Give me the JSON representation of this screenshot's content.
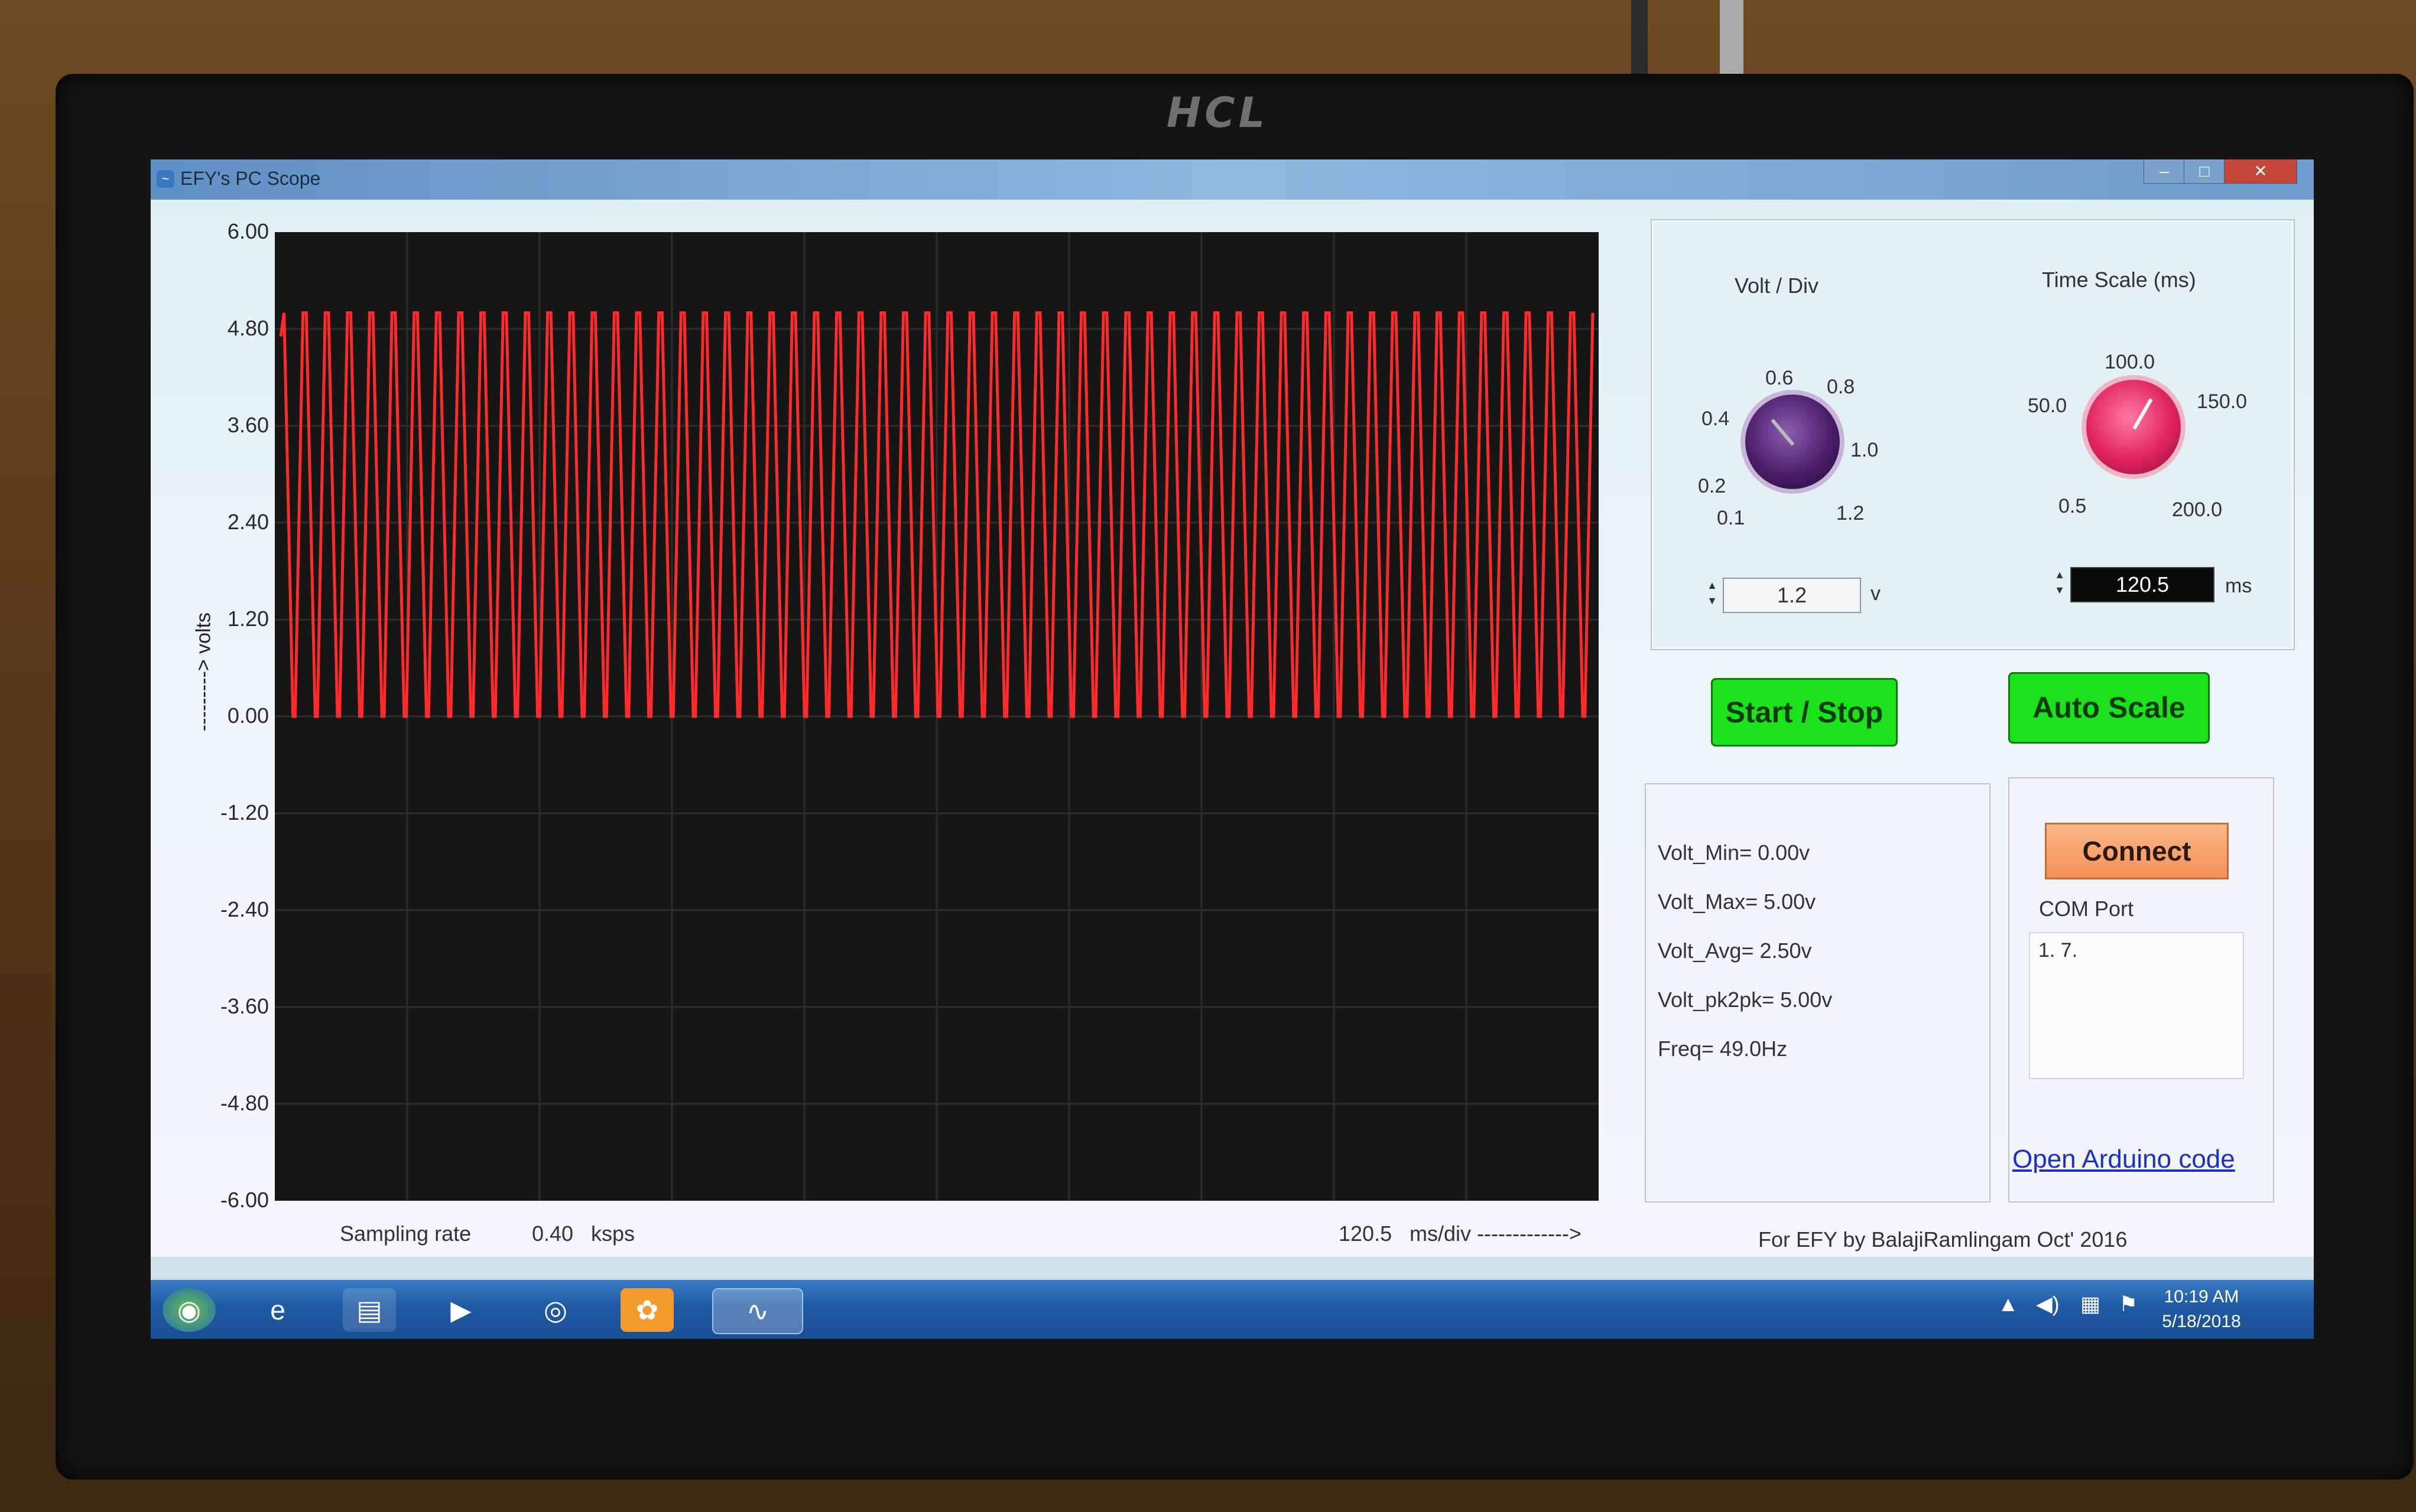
{
  "monitor": {
    "brand": "HCL"
  },
  "window": {
    "title": "EFY's PC Scope"
  },
  "plot": {
    "ylabel": "---------> volts",
    "yticks": [
      "6.00",
      "4.80",
      "3.60",
      "2.40",
      "1.20",
      "0.00",
      "-1.20",
      "-2.40",
      "-3.60",
      "-4.80",
      "-6.00"
    ]
  },
  "chart_data": {
    "type": "line",
    "ylim": [
      -6.0,
      6.0
    ],
    "ylabel": "---------> volts",
    "grid": true,
    "series": [
      {
        "waveform": "square",
        "low": 0.0,
        "high": 5.0,
        "cycles": 59,
        "color": "#ff2a2a"
      }
    ]
  },
  "bottom": {
    "sampling_label": "Sampling rate",
    "sampling_value": "0.40",
    "sampling_unit": "ksps",
    "timediv_value": "120.5",
    "timediv_unit": "ms/div ------------->",
    "credit": "For EFY by BalajiRamlingam Oct' 2016"
  },
  "volt_knob": {
    "title": "Volt / Div",
    "labels": [
      "0.1",
      "0.2",
      "0.4",
      "0.6",
      "0.8",
      "1.0",
      "1.2"
    ],
    "value": "1.2",
    "unit": "v",
    "color": "#4a1f6b"
  },
  "time_knob": {
    "title": "Time Scale (ms)",
    "labels": [
      "0.5",
      "50.0",
      "100.0",
      "150.0",
      "200.0"
    ],
    "value": "120.5",
    "unit": "ms",
    "color": "#e0245e"
  },
  "buttons": {
    "start_stop": "Start / Stop",
    "auto_scale": "Auto Scale",
    "connect": "Connect"
  },
  "stats": {
    "vmin": "Volt_Min= 0.00v",
    "vmax": "Volt_Max= 5.00v",
    "vavg": "Volt_Avg= 2.50v",
    "vpk": "Volt_pk2pk= 5.00v",
    "freq": "Freq= 49.0Hz"
  },
  "com": {
    "label": "COM Port",
    "ports": "1. 7."
  },
  "link": "Open Arduino code",
  "taskbar": {
    "time": "10:19 AM",
    "date": "5/18/2018"
  }
}
